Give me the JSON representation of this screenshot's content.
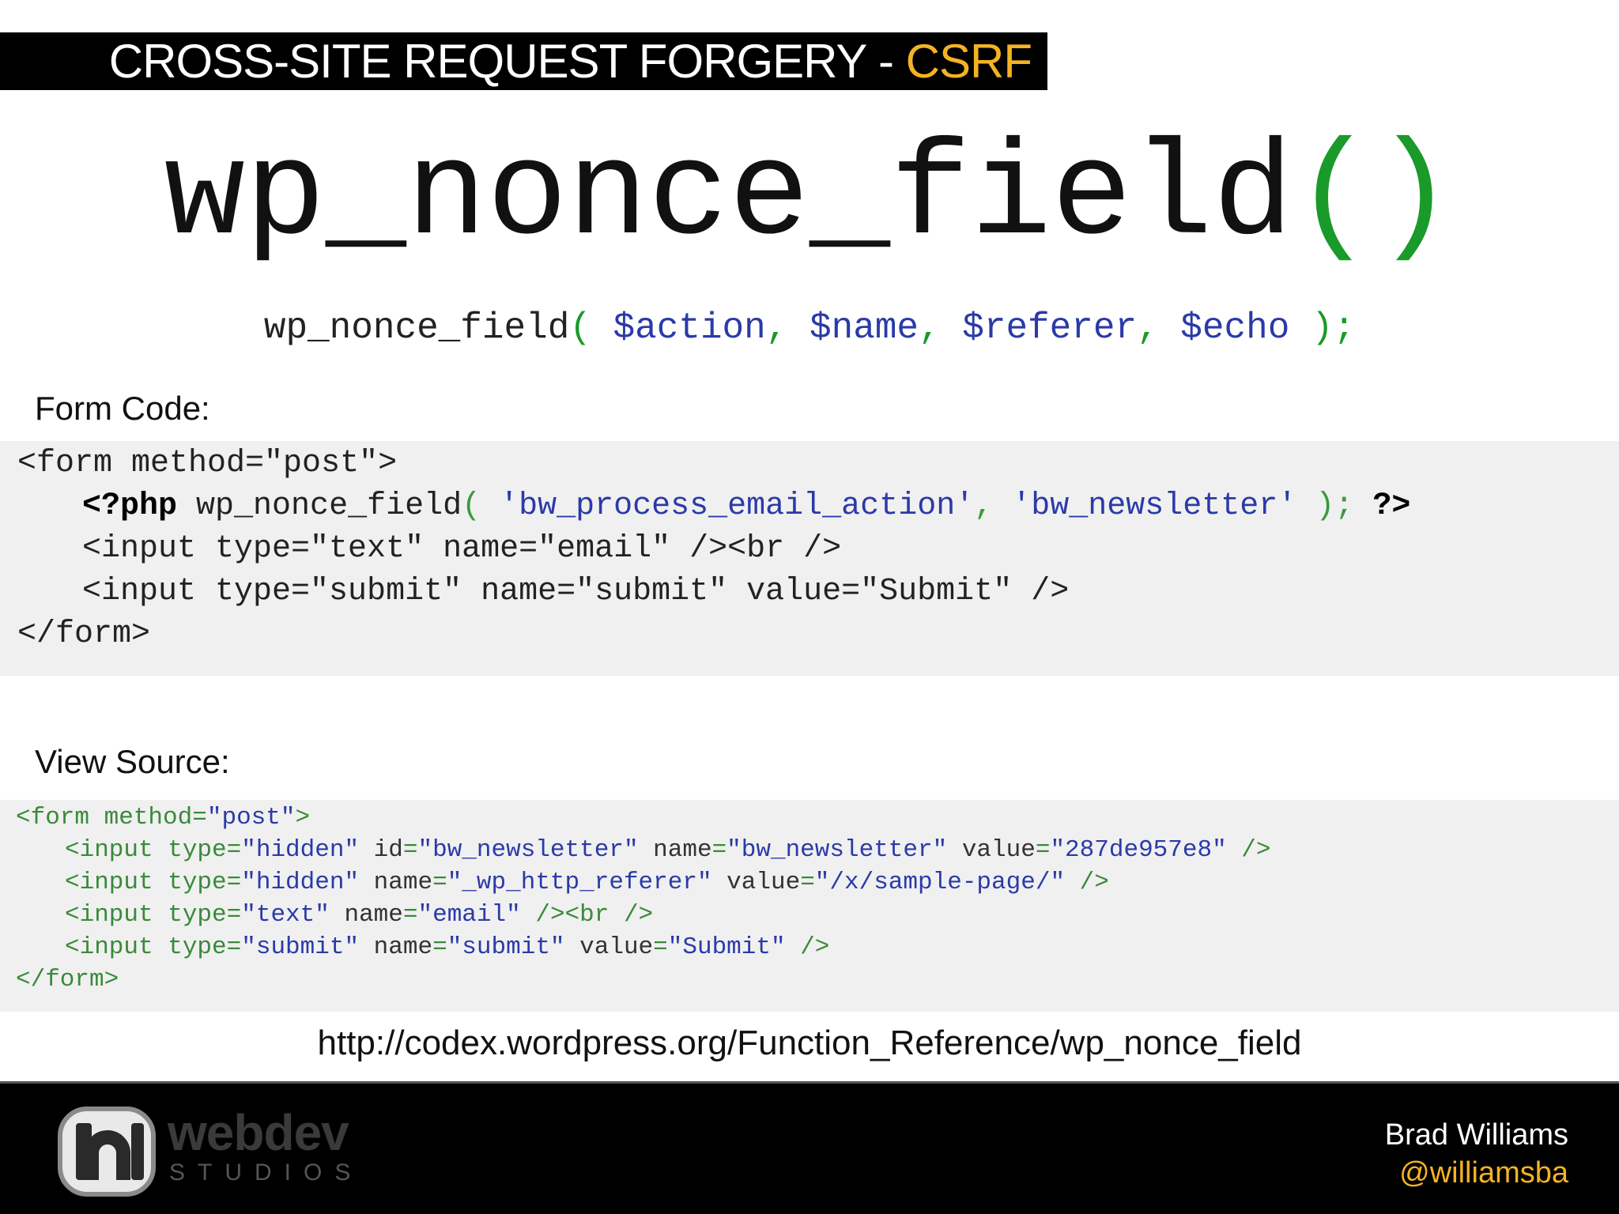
{
  "title": {
    "main": "CROSS-SITE REQUEST FORGERY - ",
    "accent": "CSRF"
  },
  "func": {
    "name": "wp_nonce_field",
    "parens": "()"
  },
  "signature": {
    "name": "wp_nonce_field",
    "open": "( ",
    "p1": "$action",
    "c1": ", ",
    "p2": "$name",
    "c2": ", ",
    "p3": "$referer",
    "c3": ", ",
    "p4": "$echo",
    "close": " );"
  },
  "form_code": {
    "label": "Form Code:",
    "line1": "<form method=\"post\">",
    "line2_php": "<?php",
    "line2_func": " wp_nonce_field",
    "line2_open": "( ",
    "line2_arg1": "'bw_process_email_action'",
    "line2_comma": ", ",
    "line2_arg2": "'bw_newsletter'",
    "line2_close": " ); ",
    "line2_end": "?>",
    "line3": "<input type=\"text\" name=\"email\" /><br />",
    "line4": "<input type=\"submit\" name=\"submit\" value=\"Submit\" />",
    "line5": "</form>"
  },
  "view_source": {
    "label": "View Source:",
    "l1": {
      "a": "<form method",
      "eq": "=",
      "v": "\"post\"",
      "end": ">"
    },
    "l2": {
      "a": "<input type",
      "v1": "\"hidden\"",
      "b": " id",
      "v2": "\"bw_newsletter\"",
      "c": " name",
      "v3": "\"bw_newsletter\"",
      "d": " value",
      "v4": "\"287de957e8\"",
      "end": " />"
    },
    "l3": {
      "a": "<input type",
      "v1": "\"hidden\"",
      "b": " name",
      "v2": "\"_wp_http_referer\"",
      "c": " value",
      "v3": "\"/x/sample-page/\"",
      "end": " />"
    },
    "l4": {
      "a": "<input type",
      "v1": "\"text\"",
      "b": " name",
      "v2": "\"email\"",
      "end": " /><br />"
    },
    "l5": {
      "a": "<input type",
      "v1": "\"submit\"",
      "b": " name",
      "v2": "\"submit\"",
      "c": " value",
      "v3": "\"Submit\"",
      "end": " />"
    },
    "l6": "</form>"
  },
  "url": "http://codex.wordpress.org/Function_Reference/wp_nonce_field",
  "footer": {
    "logo_text": "webdev",
    "logo_sub": "STUDIOS",
    "author_name": "Brad Williams",
    "author_handle": "@williamsba"
  },
  "colors": {
    "accent": "#f3b323",
    "paren_green": "#1a9a28",
    "param_blue": "#2b3aa8"
  }
}
